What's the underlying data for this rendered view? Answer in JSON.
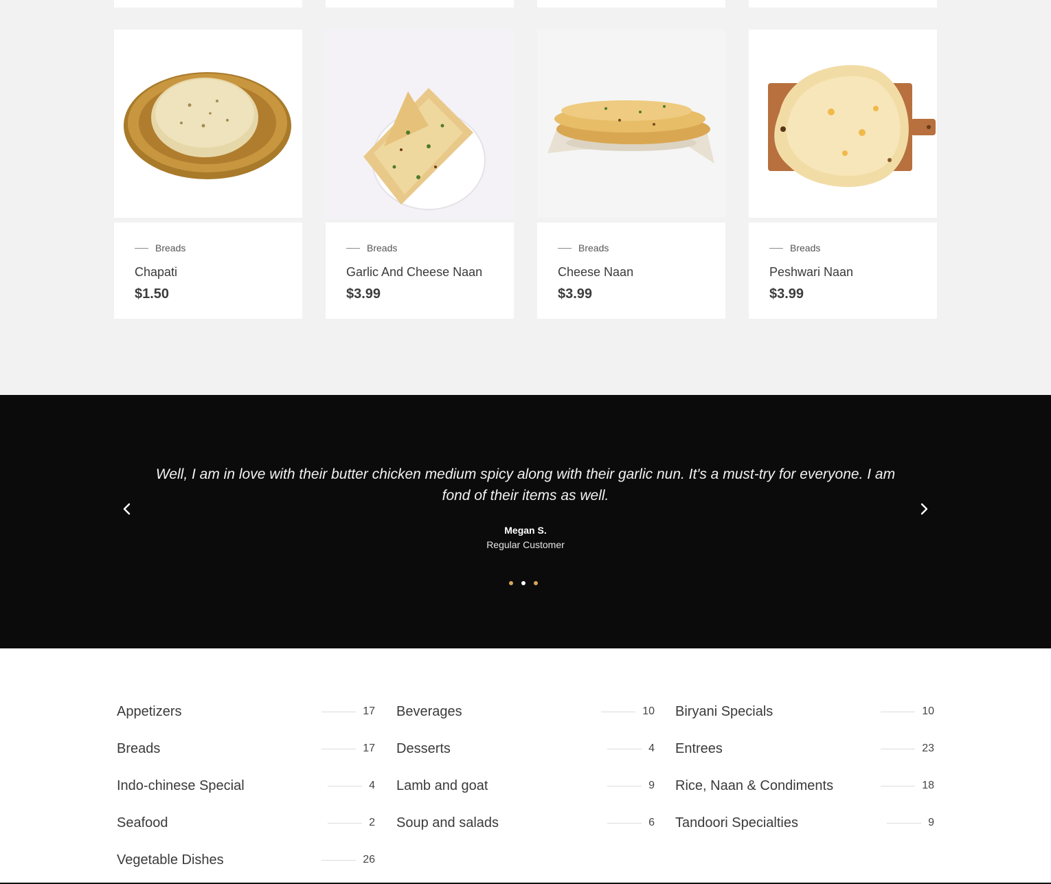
{
  "products": [
    {
      "category": "Breads",
      "name": "Chapati",
      "price": "$1.50",
      "image": "chapati-image"
    },
    {
      "category": "Breads",
      "name": "Garlic And Cheese Naan",
      "price": "$3.99",
      "image": "garlic-cheese-naan-image"
    },
    {
      "category": "Breads",
      "name": "Cheese Naan",
      "price": "$3.99",
      "image": "cheese-naan-image"
    },
    {
      "category": "Breads",
      "name": "Peshwari Naan",
      "price": "$3.99",
      "image": "peshwari-naan-image"
    }
  ],
  "testimonial": {
    "quote": "Well, I am in love with their butter chicken medium spicy along with their garlic nun. It's a must-try for everyone. I am fond of their items as well.",
    "author": "Megan S.",
    "role": "Regular Customer",
    "prev_icon": "chevron-left-icon",
    "next_icon": "chevron-right-icon",
    "active_slide": 2,
    "slide_count": 3,
    "dot_color": "#d4a85a",
    "dot_active_color": "#ffffff"
  },
  "categories": [
    {
      "name": "Appetizers",
      "count": "17"
    },
    {
      "name": "Beverages",
      "count": "10"
    },
    {
      "name": "Biryani Specials",
      "count": "10"
    },
    {
      "name": "Breads",
      "count": "17"
    },
    {
      "name": "Desserts",
      "count": "4"
    },
    {
      "name": "Entrees",
      "count": "23"
    },
    {
      "name": "Indo-chinese Special",
      "count": "4"
    },
    {
      "name": "Lamb and goat",
      "count": "9"
    },
    {
      "name": "Rice, Naan & Condiments",
      "count": "18"
    },
    {
      "name": "Seafood",
      "count": "2"
    },
    {
      "name": "Soup and salads",
      "count": "6"
    },
    {
      "name": "Tandoori Specialties",
      "count": "9"
    },
    {
      "name": "Vegetable Dishes",
      "count": "26"
    }
  ],
  "colors": {
    "page_bg": "#f2f2f2",
    "testimonial_bg": "#0b0b0c",
    "accent": "#d4a85a"
  }
}
